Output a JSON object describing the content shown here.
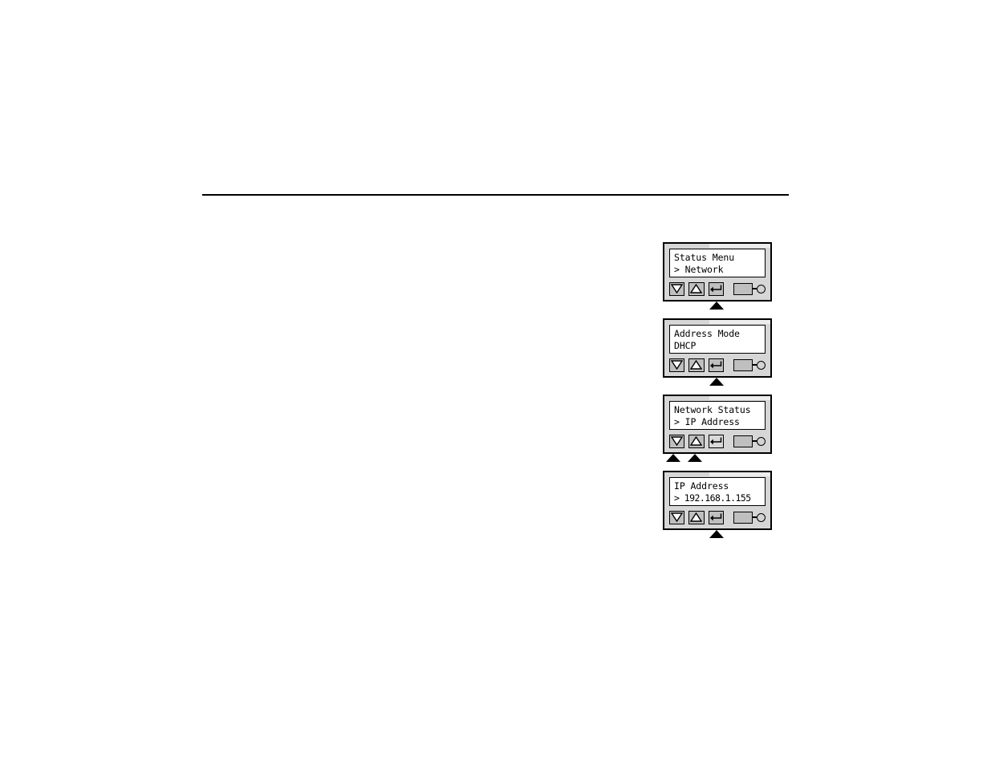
{
  "page": {
    "background_color": "#ffffff",
    "rule": {
      "color": "#000000",
      "name": "header-rule"
    }
  },
  "colors": {
    "panel_body": "#d6d6d6",
    "lcd_background": "#ffffff",
    "button_active": "#bfbfbf",
    "button_inactive": "#d9d9d9",
    "outline": "#000000",
    "led_lamp": "#d3d3d3"
  },
  "controls": {
    "down_label": "Down",
    "up_label": "Up",
    "enter_label": "Enter",
    "led_label": "Status LED",
    "down_icon": "triangle-down-icon",
    "up_icon": "triangle-up-icon",
    "enter_icon": "return-arrow-icon",
    "led_icon": "led-indicator-icon"
  },
  "panels": [
    {
      "id": "status-menu",
      "line1": "Status Menu",
      "line2": "> Network",
      "buttons": {
        "down": "active",
        "up": "active",
        "enter": "active"
      },
      "pointers": [
        "enter"
      ]
    },
    {
      "id": "address-mode",
      "line1": "Address Mode",
      "line2": "DHCP",
      "buttons": {
        "down": "active",
        "up": "active",
        "enter": "active"
      },
      "pointers": [
        "enter"
      ]
    },
    {
      "id": "network-status",
      "line1": "Network Status",
      "line2": "> IP Address",
      "buttons": {
        "down": "active",
        "up": "active",
        "enter": "inactive"
      },
      "pointers": [
        "down",
        "up"
      ]
    },
    {
      "id": "ip-address",
      "line1": "IP Address",
      "line2": "> 192.168.1.155",
      "buttons": {
        "down": "active",
        "up": "active",
        "enter": "active"
      },
      "pointers": [
        "enter"
      ]
    }
  ]
}
